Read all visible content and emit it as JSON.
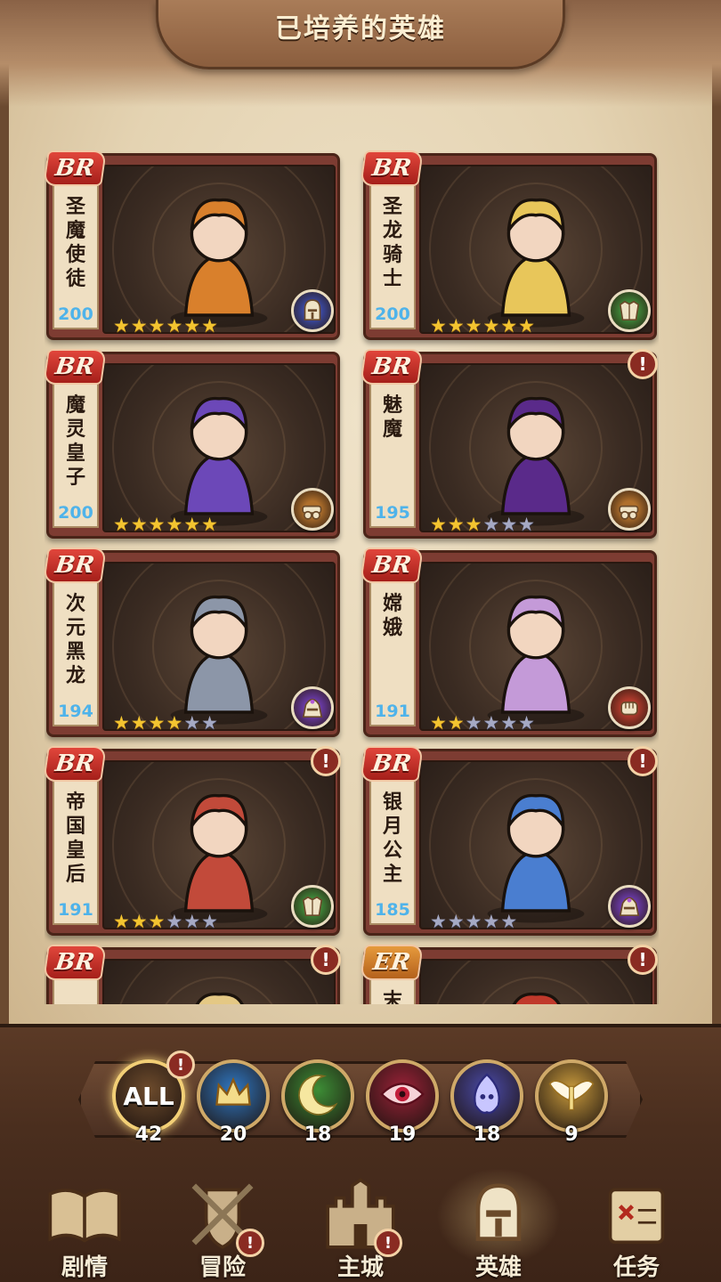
{
  "title": "已培养的英雄",
  "heroes": [
    {
      "rarity": "BR",
      "name": "圣魔使徒",
      "level": "200",
      "stars_filled": 6,
      "stars_total": 6,
      "class_icon": "knight-helmet-icon",
      "class_color": "#3b4aa8",
      "alert": false,
      "art_color": "#d9802c"
    },
    {
      "rarity": "BR",
      "name": "圣龙骑士",
      "level": "200",
      "stars_filled": 6,
      "stars_total": 6,
      "class_icon": "armor-icon",
      "class_color": "#3f8a3a",
      "alert": false,
      "art_color": "#e8c65a"
    },
    {
      "rarity": "BR",
      "name": "魔灵皇子",
      "level": "200",
      "stars_filled": 6,
      "stars_total": 6,
      "class_icon": "cannon-icon",
      "class_color": "#b0702c",
      "alert": false,
      "art_color": "#6c48b8"
    },
    {
      "rarity": "BR",
      "name": "魅魔",
      "level": "195",
      "stars_filled": 3,
      "stars_total": 6,
      "class_icon": "cannon-icon",
      "class_color": "#b0702c",
      "alert": true,
      "art_color": "#5a2a8a"
    },
    {
      "rarity": "BR",
      "name": "次元黑龙",
      "level": "194",
      "stars_filled": 4,
      "stars_total": 6,
      "class_icon": "mage-helmet-icon",
      "class_color": "#6a3aa8",
      "alert": false,
      "art_color": "#8c96a8"
    },
    {
      "rarity": "BR",
      "name": "嫦娥",
      "level": "191",
      "stars_filled": 2,
      "stars_total": 6,
      "class_icon": "fist-icon",
      "class_color": "#b03a2c",
      "alert": false,
      "art_color": "#c49ad8"
    },
    {
      "rarity": "BR",
      "name": "帝国皇后",
      "level": "191",
      "stars_filled": 3,
      "stars_total": 6,
      "class_icon": "armor-icon",
      "class_color": "#3f8a3a",
      "alert": true,
      "art_color": "#c24a3a"
    },
    {
      "rarity": "BR",
      "name": "银月公主",
      "level": "185",
      "stars_filled": 0,
      "stars_total": 5,
      "class_icon": "mage-helmet-icon",
      "class_color": "#6a3aa8",
      "alert": true,
      "art_color": "#4a7ed0"
    },
    {
      "rarity": "BR",
      "name": "",
      "level": "",
      "stars_filled": 0,
      "stars_total": 0,
      "class_icon": "",
      "class_color": "#3f8a3a",
      "alert": true,
      "art_color": "#e4c884"
    },
    {
      "rarity": "ER",
      "name": "末",
      "level": "",
      "stars_filled": 0,
      "stars_total": 0,
      "class_icon": "",
      "class_color": "#b03a2c",
      "alert": true,
      "art_color": "#c0392b"
    }
  ],
  "filters": [
    {
      "label": "ALL",
      "count": "42",
      "icon": "all-icon",
      "color": "#6d4b2c",
      "active": true,
      "alert": true
    },
    {
      "label": "",
      "count": "20",
      "icon": "crown-icon",
      "color": "#2f77c2",
      "active": false,
      "alert": false
    },
    {
      "label": "",
      "count": "18",
      "icon": "moon-icon",
      "color": "#3d8e36",
      "active": false,
      "alert": false
    },
    {
      "label": "",
      "count": "19",
      "icon": "eye-icon",
      "color": "#9b2238",
      "active": false,
      "alert": false
    },
    {
      "label": "",
      "count": "18",
      "icon": "ghost-flame-icon",
      "color": "#4a4aa8",
      "active": false,
      "alert": false
    },
    {
      "label": "",
      "count": "9",
      "icon": "angel-wings-icon",
      "color": "#c89a3c",
      "active": false,
      "alert": false
    }
  ],
  "nav": [
    {
      "label": "剧情",
      "icon": "book-icon",
      "active": false,
      "alert": false
    },
    {
      "label": "冒险",
      "icon": "swords-shield-icon",
      "active": false,
      "alert": true
    },
    {
      "label": "主城",
      "icon": "castle-icon",
      "active": false,
      "alert": true
    },
    {
      "label": "英雄",
      "icon": "knight-helmet-icon",
      "active": true,
      "alert": false
    },
    {
      "label": "任务",
      "icon": "quest-scroll-icon",
      "active": false,
      "alert": false
    }
  ],
  "alert_symbol": "!"
}
